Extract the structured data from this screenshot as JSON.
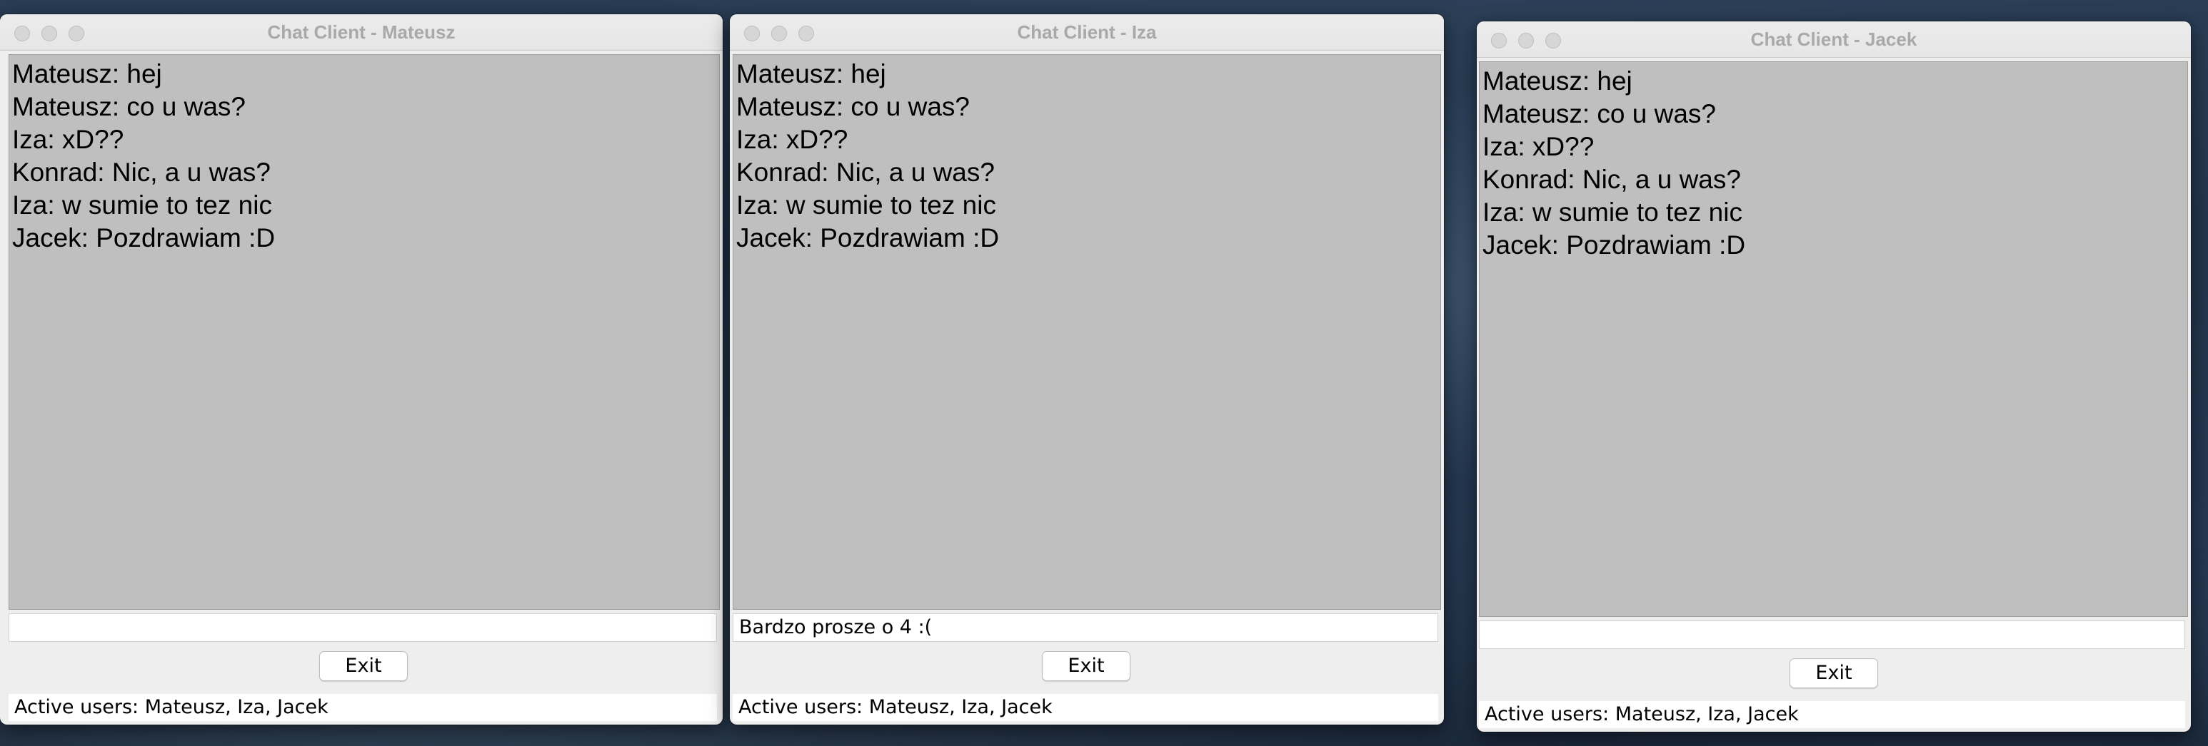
{
  "windows": [
    {
      "title": "Chat Client - Mateusz",
      "messages": [
        "Mateusz: hej",
        "Mateusz: co u was?",
        "Iza: xD??",
        "Konrad: Nic, a u was?",
        "Iza: w sumie to tez nic",
        "Jacek: Pozdrawiam :D"
      ],
      "input_value": "",
      "exit_label": "Exit",
      "status": "Active users: Mateusz, Iza, Jacek"
    },
    {
      "title": "Chat Client - Iza",
      "messages": [
        "Mateusz: hej",
        "Mateusz: co u was?",
        "Iza: xD??",
        "Konrad: Nic, a u was?",
        "Iza: w sumie to tez nic",
        "Jacek: Pozdrawiam :D"
      ],
      "input_value": "Bardzo prosze o 4 :(",
      "exit_label": "Exit",
      "status": "Active users: Mateusz, Iza, Jacek"
    },
    {
      "title": "Chat Client - Jacek",
      "messages": [
        "Mateusz: hej",
        "Mateusz: co u was?",
        "Iza: xD??",
        "Konrad: Nic, a u was?",
        "Iza: w sumie to tez nic",
        "Jacek: Pozdrawiam :D"
      ],
      "input_value": "",
      "exit_label": "Exit",
      "status": "Active users: Mateusz, Iza, Jacek"
    }
  ]
}
